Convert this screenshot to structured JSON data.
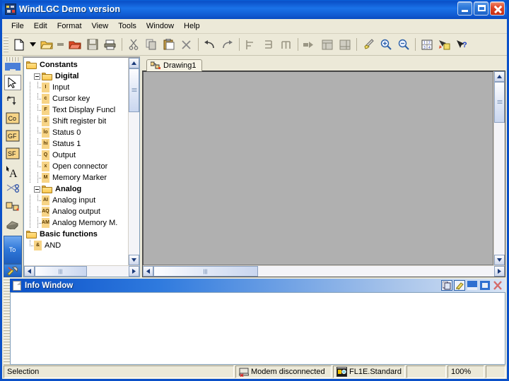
{
  "window": {
    "title": "WindLGC Demo version",
    "icon": "app-icon",
    "controls": {
      "minimize": "Minimize",
      "maximize": "Maximize",
      "close": "Close"
    }
  },
  "menu": {
    "items": [
      {
        "label": "File"
      },
      {
        "label": "Edit"
      },
      {
        "label": "Format"
      },
      {
        "label": "View"
      },
      {
        "label": "Tools"
      },
      {
        "label": "Window"
      },
      {
        "label": "Help"
      }
    ]
  },
  "toolbar": {
    "items": [
      {
        "name": "new-document-icon",
        "title": "New"
      },
      {
        "name": "dropdown-arrow-icon",
        "title": "New type"
      },
      {
        "name": "open-folder-icon",
        "title": "Open"
      },
      {
        "name": "open-small-icon",
        "title": "Open recent"
      },
      {
        "name": "open-red-folder-icon",
        "title": "Open from LOGO!"
      },
      {
        "name": "save-icon",
        "title": "Save"
      },
      {
        "name": "print-icon",
        "title": "Print"
      },
      {
        "name": "cut-icon",
        "title": "Cut"
      },
      {
        "name": "copy-icon",
        "title": "Copy"
      },
      {
        "name": "paste-icon",
        "title": "Paste"
      },
      {
        "name": "delete-icon",
        "title": "Delete"
      },
      {
        "name": "undo-icon",
        "title": "Undo"
      },
      {
        "name": "redo-icon",
        "title": "Redo"
      },
      {
        "name": "align-left-icon",
        "title": "Align left"
      },
      {
        "name": "align-center-icon",
        "title": "Align center"
      },
      {
        "name": "align-right-icon",
        "title": "Align right"
      },
      {
        "name": "arrow-right-icon",
        "title": "Connect"
      },
      {
        "name": "page-view-icon",
        "title": "Page view"
      },
      {
        "name": "page-layout-icon",
        "title": "Page layout"
      },
      {
        "name": "paintbrush-icon",
        "title": "Format painter"
      },
      {
        "name": "zoom-in-icon",
        "title": "Zoom in"
      },
      {
        "name": "zoom-out-icon",
        "title": "Zoom out"
      },
      {
        "name": "grid-icon",
        "title": "Grid"
      },
      {
        "name": "select-tool-icon",
        "title": "Selection tool"
      },
      {
        "name": "help-pointer-icon",
        "title": "What's this?"
      }
    ]
  },
  "vertical_toolbar": {
    "items": [
      {
        "name": "selection-arrow-tool",
        "label": "",
        "active": true
      },
      {
        "name": "connector-tool",
        "label": ""
      },
      {
        "name": "constants-tool",
        "label": "Co"
      },
      {
        "name": "basic-functions-tool",
        "label": "GF"
      },
      {
        "name": "special-functions-tool",
        "label": "SF"
      },
      {
        "name": "text-tool",
        "label": "A"
      },
      {
        "name": "cut-connection-tool",
        "label": ""
      },
      {
        "name": "simulation-tool",
        "label": ""
      },
      {
        "name": "online-test-tool",
        "label": ""
      }
    ],
    "tab_label": "To",
    "tools_label": "tools"
  },
  "tree": {
    "nodes": [
      {
        "label": "Constants",
        "type": "folder",
        "depth": 0,
        "bold": true,
        "expander": false
      },
      {
        "label": "Digital",
        "type": "folder",
        "depth": 1,
        "bold": true,
        "expander": true
      },
      {
        "label": "Input",
        "type": "leaf",
        "depth": 2,
        "icon": "I"
      },
      {
        "label": "Cursor key",
        "type": "leaf",
        "depth": 2,
        "icon": "c"
      },
      {
        "label": "Text Display Funcl",
        "type": "leaf",
        "depth": 2,
        "icon": "F"
      },
      {
        "label": "Shift register bit",
        "type": "leaf",
        "depth": 2,
        "icon": "S"
      },
      {
        "label": "Status 0",
        "type": "leaf",
        "depth": 2,
        "icon": "lo"
      },
      {
        "label": "Status 1",
        "type": "leaf",
        "depth": 2,
        "icon": "hi"
      },
      {
        "label": "Output",
        "type": "leaf",
        "depth": 2,
        "icon": "Q"
      },
      {
        "label": "Open connector",
        "type": "leaf",
        "depth": 2,
        "icon": "x"
      },
      {
        "label": "Memory Marker",
        "type": "leaf",
        "depth": 2,
        "icon": "M"
      },
      {
        "label": "Analog",
        "type": "folder",
        "depth": 1,
        "bold": true,
        "expander": true
      },
      {
        "label": "Analog input",
        "type": "leaf",
        "depth": 2,
        "icon": "AI"
      },
      {
        "label": "Analog output",
        "type": "leaf",
        "depth": 2,
        "icon": "AQ"
      },
      {
        "label": "Analog Memory M.",
        "type": "leaf",
        "depth": 2,
        "icon": "AM"
      },
      {
        "label": "Basic functions",
        "type": "folder",
        "depth": 0,
        "bold": true,
        "expander": false
      },
      {
        "label": "AND",
        "type": "leaf",
        "depth": 1,
        "icon": "&"
      }
    ]
  },
  "document": {
    "tabs": [
      {
        "label": "Drawing1",
        "icon": "circuit-icon",
        "active": true
      }
    ]
  },
  "info_window": {
    "title": "Info Window",
    "content": "",
    "buttons": [
      {
        "name": "copy-button",
        "title": "Copy"
      },
      {
        "name": "clear-button",
        "title": "Clear"
      },
      {
        "name": "minimize-button",
        "title": "Minimize"
      },
      {
        "name": "maximize-button",
        "title": "Maximize"
      },
      {
        "name": "close-button",
        "title": "Close"
      }
    ]
  },
  "statusbar": {
    "mode": "Selection",
    "modem": "Modem disconnected",
    "device": "FL1E.Standard",
    "spacer": "",
    "zoom": "100%",
    "end": ""
  },
  "colors": {
    "title_blue": "#0a50c8",
    "accent_blue": "#1a72e8",
    "canvas_grey": "#b0b0b0",
    "face": "#ece9d8",
    "folder_yellow": "#fdc94f",
    "close_red": "#e0482a"
  }
}
